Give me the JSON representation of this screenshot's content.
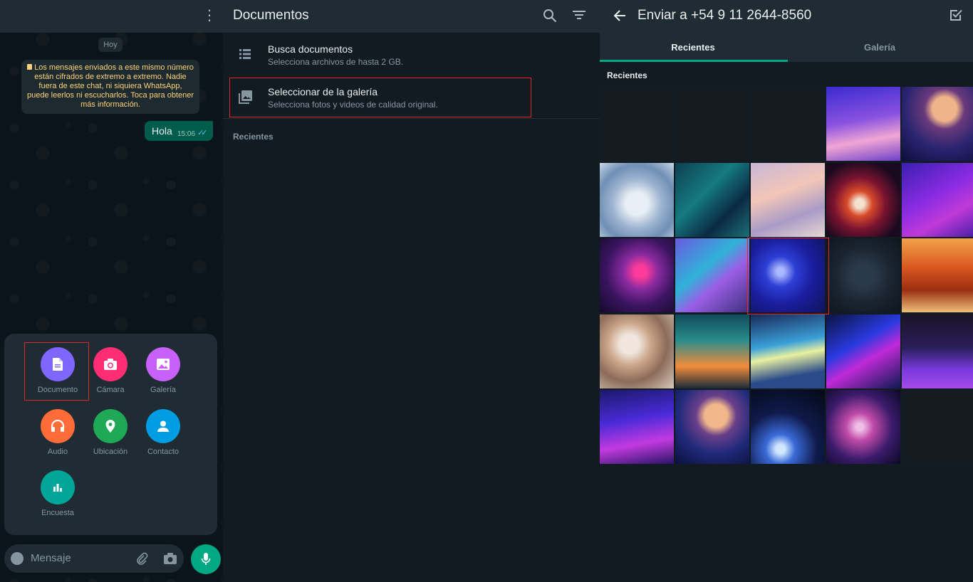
{
  "chat": {
    "date_chip": "Hoy",
    "encryption_notice": "Los mensajes enviados a este mismo número están cifrados de extremo a extremo. Nadie fuera de este chat, ni siquiera WhatsApp, puede leerlos ni escucharlos. Toca para obtener más información.",
    "message": {
      "text": "Hola",
      "time": "15:06"
    },
    "attach_menu": [
      {
        "label": "Documento",
        "icon": "document-icon",
        "color": "#7f66ff"
      },
      {
        "label": "Cámara",
        "icon": "camera-icon",
        "color": "#ff2e74"
      },
      {
        "label": "Galería",
        "icon": "gallery-icon",
        "color": "#c861fa"
      },
      {
        "label": "Audio",
        "icon": "headphones-icon",
        "color": "#ff6c37"
      },
      {
        "label": "Ubicación",
        "icon": "location-pin-icon",
        "color": "#1fa855"
      },
      {
        "label": "Contacto",
        "icon": "contact-icon",
        "color": "#009de2"
      },
      {
        "label": "Encuesta",
        "icon": "poll-icon",
        "color": "#02a698"
      }
    ],
    "input_placeholder": "Mensaje",
    "accent": "#00a884"
  },
  "documents": {
    "title": "Documentos",
    "options": [
      {
        "title": "Busca documentos",
        "subtitle": "Selecciona archivos de hasta 2 GB.",
        "icon": "list-icon"
      },
      {
        "title": "Seleccionar de la galería",
        "subtitle": "Selecciona fotos y videos de calidad original.",
        "icon": "gallery-icon"
      }
    ],
    "section": "Recientes"
  },
  "gallery": {
    "title": "Enviar a +54 9 11 2644-8560",
    "tabs": [
      {
        "label": "Recientes",
        "active": true
      },
      {
        "label": "Galería",
        "active": false
      }
    ],
    "section": "Recientes",
    "thumbnails": [
      {
        "name": "dark-blank",
        "bg": "#141c22"
      },
      {
        "name": "dark-blank",
        "bg": "#141c22"
      },
      {
        "name": "dark-blank",
        "bg": "#141c22"
      },
      {
        "name": "pink-dunes",
        "bg": "linear-gradient(170deg,#3b2bd1 0%,#8a52e0 45%,#f0a6d4 70%,#6e3fc8 100%)"
      },
      {
        "name": "saturn",
        "bg": "radial-gradient(circle at 60% 30%,#f0b48a 0 18%,#6a3a7c 30%,#2a2470 60%,#0c0d3a 100%)"
      },
      {
        "name": "white-bloom",
        "bg": "radial-gradient(circle at 50% 55%,#e8eef6 0 20%,#9db3cf 45%,#6f8fb5 70%,#c9d6e6 100%)"
      },
      {
        "name": "teal-silk",
        "bg": "linear-gradient(135deg,#0e3f52 0%,#157a7e 40%,#0a2a44 70%,#1b6f77 100%)"
      },
      {
        "name": "pastel-waves",
        "bg": "linear-gradient(160deg,#c8b7d6 0%,#f2c6b8 40%,#a99bc6 70%,#e7d7d2 100%)"
      },
      {
        "name": "red-swirl",
        "bg": "radial-gradient(circle at 45% 55%,#f2e2cf 0 8%,#d84a2a 22%,#7a1330 45%,#1a0a1f 75%)"
      },
      {
        "name": "violet-lines",
        "bg": "linear-gradient(150deg,#3a1fb0 0%,#8a2be2 45%,#c03ad8 70%,#4b1fa8 100%)"
      },
      {
        "name": "magenta-glow",
        "bg": "radial-gradient(circle at 55% 45%,#ff3b9a 0 10%,#8a2ba0 30%,#3a1460 60%,#140a2a 100%)"
      },
      {
        "name": "fan-ribbon",
        "bg": "linear-gradient(140deg,#6a5ae0 0%,#2fb2d8 40%,#9b5ee6 60%,#3b2f7a 100%)"
      },
      {
        "name": "blue-marble",
        "bg": "radial-gradient(circle at 40% 45%,#aab8ff 0 6%,#2d3fd6 25%,#1a1d9c 55%,#0f145c 100%)"
      },
      {
        "name": "dark-smoke",
        "bg": "radial-gradient(circle at 50% 50%,#2b3a4a 0 20%,#1a2430 55%,#0f151c 100%)"
      },
      {
        "name": "autumn-path",
        "bg": "linear-gradient(180deg,#f2a24a 0%,#d9561f 40%,#9b2f12 70%,#f0c07a 100%)"
      },
      {
        "name": "rain-glass",
        "bg": "radial-gradient(circle at 40% 40%,#f0e6dc 0 15%,#c9a487 35%,#8c6b5a 60%,#d8c8bc 100%)"
      },
      {
        "name": "sunset-sea",
        "bg": "linear-gradient(180deg,#0f4c5c 0%,#2a8c8c 35%,#f28c3a 70%,#1a2a3a 100%)"
      },
      {
        "name": "light-streaks",
        "bg": "linear-gradient(170deg,#1a2a5a 0%,#3aa0d8 40%,#e8f0a0 55%,#2a4a8a 80%)"
      },
      {
        "name": "blue-rays",
        "bg": "linear-gradient(150deg,#0a1440 0%,#2a3ae0 40%,#c02ad8 60%,#0a1a50 100%)"
      },
      {
        "name": "purple-horizon",
        "bg": "linear-gradient(180deg,#1a1426 0%,#2a1f5a 45%,#7a3ae0 75%,#a64ae8 100%)"
      },
      {
        "name": "violet-haze",
        "bg": "linear-gradient(170deg,#1a1a6a 0%,#4a2ad8 40%,#c23ae0 70%,#2a1466 100%)"
      },
      {
        "name": "ringed-planet",
        "bg": "radial-gradient(circle at 55% 35%,#f0b88a 0 18%,#6a3f8a 32%,#202a7a 60%,#0a0f3a 100%)"
      },
      {
        "name": "planet-arc",
        "bg": "radial-gradient(circle at 40% 80%,#d0e8ff 0 6%,#3a6ad8 20%,#0f1a4a 50%,#050814 100%)"
      },
      {
        "name": "pink-nebula",
        "bg": "radial-gradient(circle at 45% 50%,#f0c0e8 0 6%,#c04aa8 25%,#3a1a6a 60%,#0a0a24 100%)"
      },
      {
        "name": "whatsapp-screen",
        "bg": "#151c21"
      }
    ]
  }
}
